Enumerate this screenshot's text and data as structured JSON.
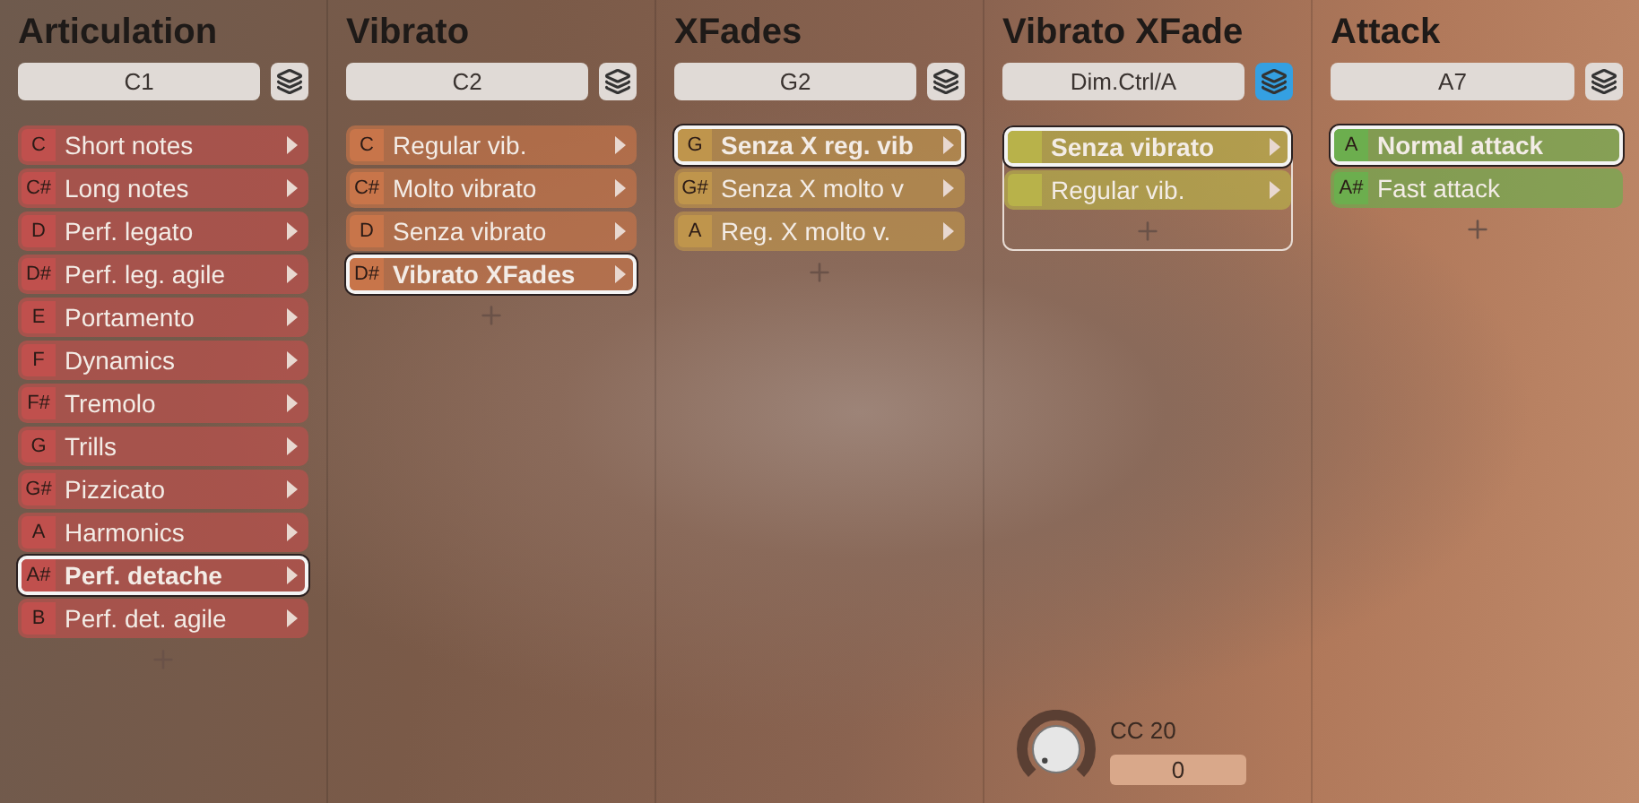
{
  "columns": [
    {
      "title": "Articulation",
      "trigger": "C1",
      "layers_active": false,
      "color": "#c0504d",
      "grouped": false,
      "items": [
        {
          "key": "C",
          "label": "Short notes",
          "selected": false,
          "arrow": true
        },
        {
          "key": "C#",
          "label": "Long notes",
          "selected": false,
          "arrow": true
        },
        {
          "key": "D",
          "label": "Perf. legato",
          "selected": false,
          "arrow": true
        },
        {
          "key": "D#",
          "label": "Perf. leg. agile",
          "selected": false,
          "arrow": true
        },
        {
          "key": "E",
          "label": "Portamento",
          "selected": false,
          "arrow": true
        },
        {
          "key": "F",
          "label": "Dynamics",
          "selected": false,
          "arrow": true
        },
        {
          "key": "F#",
          "label": "Tremolo",
          "selected": false,
          "arrow": true
        },
        {
          "key": "G",
          "label": "Trills",
          "selected": false,
          "arrow": true
        },
        {
          "key": "G#",
          "label": "Pizzicato",
          "selected": false,
          "arrow": true
        },
        {
          "key": "A",
          "label": "Harmonics",
          "selected": false,
          "arrow": true
        },
        {
          "key": "A#",
          "label": "Perf. detache",
          "selected": true,
          "arrow": true
        },
        {
          "key": "B",
          "label": "Perf. det. agile",
          "selected": false,
          "arrow": true
        }
      ]
    },
    {
      "title": "Vibrato",
      "trigger": "C2",
      "layers_active": false,
      "color": "#c8754a",
      "grouped": false,
      "items": [
        {
          "key": "C",
          "label": "Regular vib.",
          "selected": false,
          "arrow": true
        },
        {
          "key": "C#",
          "label": "Molto vibrato",
          "selected": false,
          "arrow": true
        },
        {
          "key": "D",
          "label": "Senza vibrato",
          "selected": false,
          "arrow": true
        },
        {
          "key": "D#",
          "label": "Vibrato XFades",
          "selected": true,
          "arrow": true
        }
      ]
    },
    {
      "title": "XFades",
      "trigger": "G2",
      "layers_active": false,
      "color": "#bf954c",
      "grouped": false,
      "items": [
        {
          "key": "G",
          "label": "Senza X reg. vib",
          "selected": true,
          "arrow": true
        },
        {
          "key": "G#",
          "label": "Senza X molto v",
          "selected": false,
          "arrow": true
        },
        {
          "key": "A",
          "label": "Reg. X molto v.",
          "selected": false,
          "arrow": true
        }
      ]
    },
    {
      "title": "Vibrato XFade",
      "trigger": "Dim.Ctrl/A",
      "layers_active": true,
      "color": "#b8b24a",
      "grouped": true,
      "items": [
        {
          "label": "Senza vibrato",
          "selected": true,
          "arrow": true
        },
        {
          "label": "Regular vib.",
          "selected": false,
          "arrow": true
        }
      ],
      "knob": {
        "label": "CC 20",
        "value": "0"
      }
    },
    {
      "title": "Attack",
      "trigger": "A7",
      "layers_active": false,
      "color": "#6cae4e",
      "grouped": false,
      "items": [
        {
          "key": "A",
          "label": "Normal attack",
          "selected": true,
          "arrow": false
        },
        {
          "key": "A#",
          "label": "Fast attack",
          "selected": false,
          "arrow": false
        }
      ]
    }
  ]
}
